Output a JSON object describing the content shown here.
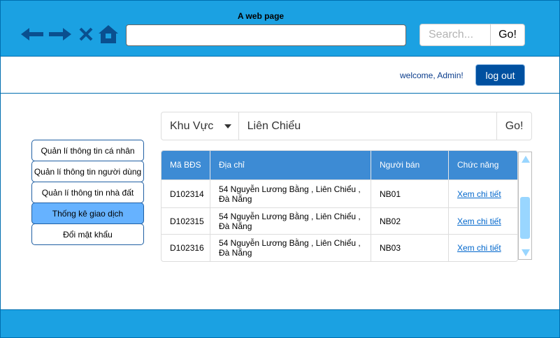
{
  "browser": {
    "title": "A web page",
    "url_value": "",
    "search_placeholder": "Search...",
    "search_go": "Go!",
    "accent_color": "#1ba1e2",
    "icons": [
      "arrow-left-icon",
      "arrow-right-icon",
      "close-icon",
      "home-icon"
    ]
  },
  "header": {
    "welcome": "welcome, Admin!",
    "logout_label": "log out"
  },
  "sidebar": {
    "items": [
      {
        "label": "Quản lí thông tin cá nhân",
        "active": false
      },
      {
        "label": "Quản lí thông tin người dùng",
        "active": false
      },
      {
        "label": "Quản lí thông tin nhà đất",
        "active": false
      },
      {
        "label": "Thống kê giao dịch",
        "active": true
      },
      {
        "label": "Đổi mật khẩu",
        "active": false
      }
    ]
  },
  "filter": {
    "select_value": "Khu Vực",
    "input_value": "Liên Chiểu",
    "go_label": "Go!"
  },
  "table": {
    "columns": [
      "Mã BĐS",
      "Địa chỉ",
      "Người bán",
      "Chức năng"
    ],
    "rows": [
      {
        "code": "D102314",
        "address": "54 Nguyễn Lương Bằng , Liên Chiểu , Đà Nẵng",
        "seller": "NB01",
        "action": "Xem chi tiết"
      },
      {
        "code": "D102315",
        "address": "54 Nguyễn Lương Bằng , Liên Chiểu , Đà Nẵng",
        "seller": "NB02",
        "action": "Xem chi tiết"
      },
      {
        "code": "D102316",
        "address": "54 Nguyễn Lương Bằng , Liên Chiểu , Đà Nẵng",
        "seller": "NB03",
        "action": "Xem chi tiết"
      }
    ],
    "header_color": "#3d8bd4"
  }
}
